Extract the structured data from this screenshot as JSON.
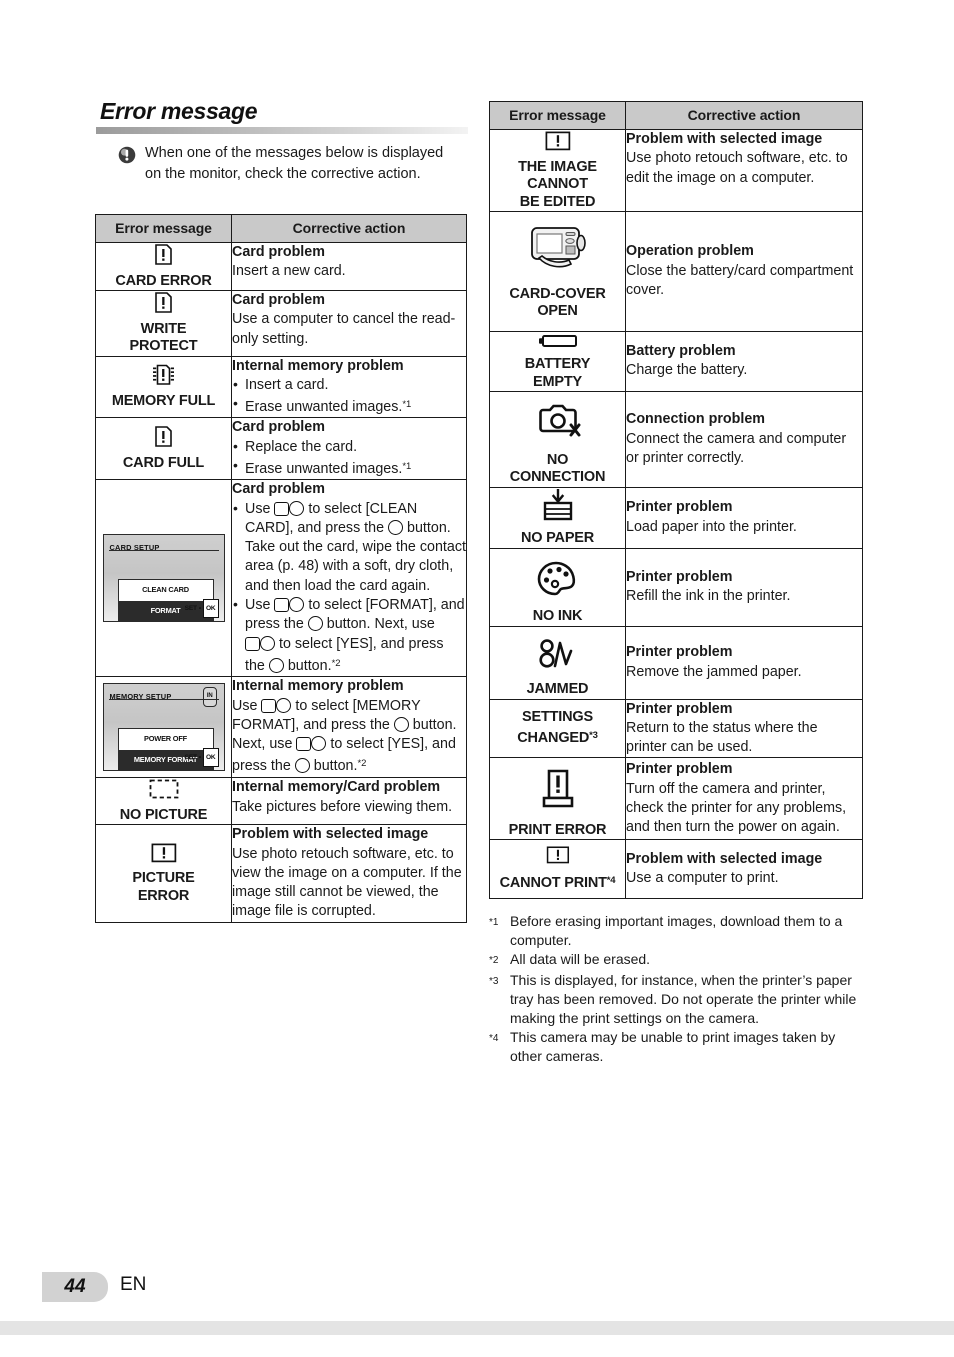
{
  "page": {
    "title": "Error message",
    "number": "44",
    "language": "EN"
  },
  "note": {
    "icon": "exclamation-note-icon",
    "text": "When one of the messages below is displayed on the monitor, check the corrective action."
  },
  "table_headers": {
    "error_message": "Error message",
    "corrective_action": "Corrective action"
  },
  "left_table": {
    "rows": [
      {
        "icon": "card-error-icon",
        "message": "CARD ERROR",
        "action_title": "Card problem",
        "action_lines": [
          "Insert a new card."
        ]
      },
      {
        "icon": "card-error-icon",
        "message": "WRITE\nPROTECT",
        "action_title": "Card problem",
        "action_lines": [
          "Use a computer to cancel the read-only setting."
        ]
      },
      {
        "icon": "memory-chip-icon",
        "message": "MEMORY FULL",
        "action_title": "Internal memory problem",
        "bullets": [
          "Insert a card.",
          "Erase unwanted images."
        ],
        "bullet_footnotes": [
          "",
          "*1"
        ]
      },
      {
        "icon": "card-error-icon",
        "message": "CARD FULL",
        "action_title": "Card problem",
        "bullets": [
          "Replace the card.",
          "Erase unwanted images."
        ],
        "bullet_footnotes": [
          "",
          "*1"
        ]
      },
      {
        "icon": "lcd-card-setup",
        "screen": {
          "title": "CARD SETUP",
          "options": [
            "CLEAN CARD",
            "FORMAT"
          ],
          "selected_index": 1,
          "hint": "SET",
          "hint_key": "OK"
        },
        "message": "",
        "action_title": "Card problem",
        "bullets": [
          "Use [arrow-pad-icons] to select [CLEAN CARD], and press the [ok-func-button] button. Take out the card, wipe the contact area (p. 48) with a soft, dry cloth, and then load the card again.",
          "Use [arrow-pad-icons] to select [FORMAT], and press the [ok-func-button] button. Next, use [arrow-pad-icons] to select [YES], and press the [ok-func-button] button."
        ],
        "bullet_footnotes": [
          "",
          "*2"
        ]
      },
      {
        "icon": "lcd-memory-setup",
        "screen": {
          "title": "MEMORY SETUP",
          "badge": "IN",
          "options": [
            "POWER OFF",
            "MEMORY FORMAT"
          ],
          "selected_index": 1,
          "hint": "SET",
          "hint_key": "OK"
        },
        "message": "",
        "action_title": "Internal memory problem",
        "action_text": "Use [arrow-pad-icons] to select [MEMORY FORMAT], and press the [ok-func-button] button. Next, use [arrow-pad-icons] to select [YES], and press the [ok-func-button] button.",
        "footnote": "*2"
      },
      {
        "icon": "no-picture-icon",
        "message": "NO PICTURE",
        "action_title": "Internal memory/Card problem",
        "action_lines": [
          "Take pictures before viewing them."
        ]
      },
      {
        "icon": "picture-error-icon",
        "message": "PICTURE\nERROR",
        "action_title": "Problem with selected image",
        "action_lines": [
          "Use photo retouch software, etc. to view the image on a computer. If the image still cannot be viewed, the image file is corrupted."
        ]
      }
    ]
  },
  "right_table": {
    "rows": [
      {
        "icon": "picture-error-icon",
        "message": "THE IMAGE\nCANNOT\nBE EDITED",
        "action_title": "Problem with selected image",
        "action_lines": [
          "Use photo retouch software, etc. to edit the image on a computer."
        ]
      },
      {
        "icon": "camera-card-cover-icon",
        "message": "CARD-COVER\nOPEN",
        "action_title": "Operation problem",
        "action_lines": [
          "Close the battery/card compartment cover."
        ]
      },
      {
        "icon": "battery-empty-icon",
        "message": "BATTERY\nEMPTY",
        "action_title": "Battery problem",
        "action_lines": [
          "Charge the battery."
        ]
      },
      {
        "icon": "no-connection-icon",
        "message": "NO\nCONNECTION",
        "action_title": "Connection problem",
        "action_lines": [
          "Connect the camera and computer or printer correctly."
        ]
      },
      {
        "icon": "no-paper-icon",
        "message": "NO PAPER",
        "action_title": "Printer problem",
        "action_lines": [
          "Load paper into the printer."
        ]
      },
      {
        "icon": "no-ink-icon",
        "message": "NO INK",
        "action_title": "Printer problem",
        "action_lines": [
          "Refill the ink in the printer."
        ]
      },
      {
        "icon": "jammed-icon",
        "message": "JAMMED",
        "action_title": "Printer problem",
        "action_lines": [
          "Remove the jammed paper."
        ]
      },
      {
        "icon": "",
        "message": "SETTINGS\nCHANGED",
        "footnote": "*3",
        "action_title": "Printer problem",
        "action_lines": [
          "Return to the status where the printer can be used."
        ]
      },
      {
        "icon": "print-error-icon",
        "message": "PRINT ERROR",
        "action_title": "Printer problem",
        "action_lines": [
          "Turn off the camera and printer, check the printer for any problems, and then turn the power on again."
        ]
      },
      {
        "icon": "picture-error-icon",
        "message": "CANNOT PRINT",
        "footnote": "*4",
        "action_title": "Problem with selected image",
        "action_lines": [
          "Use a computer to print."
        ]
      }
    ]
  },
  "footnotes": [
    {
      "mark": "*1",
      "text": "Before erasing important images, download them to a computer."
    },
    {
      "mark": "*2",
      "text": "All data will be erased."
    },
    {
      "mark": "*3",
      "text": "This is displayed, for instance, when the printer’s paper tray has been removed. Do not operate the printer while making the print settings on the camera."
    },
    {
      "mark": "*4",
      "text": "This camera may be unable to print images taken by other cameras."
    }
  ],
  "strings": {
    "clean_card_bullet_p1": "Use ",
    "clean_card_bullet_p2": " to select [CLEAN CARD], and press the ",
    "clean_card_bullet_p3": " button. Take out the card, wipe the contact area (p. 48) with a soft, dry cloth, and then load the card again.",
    "format_bullet_p1": "Use ",
    "format_bullet_p2": " to select [FORMAT], and press the ",
    "format_bullet_p3": " button. Next, use ",
    "format_bullet_p4": " to select [YES], and press the ",
    "format_bullet_p5": " button.",
    "memfmt_p1": "Use ",
    "memfmt_p2": " to select [MEMORY FORMAT], and press the ",
    "memfmt_p3": " button. Next, use ",
    "memfmt_p4": " to select [YES], and press the ",
    "memfmt_p5": " button."
  }
}
